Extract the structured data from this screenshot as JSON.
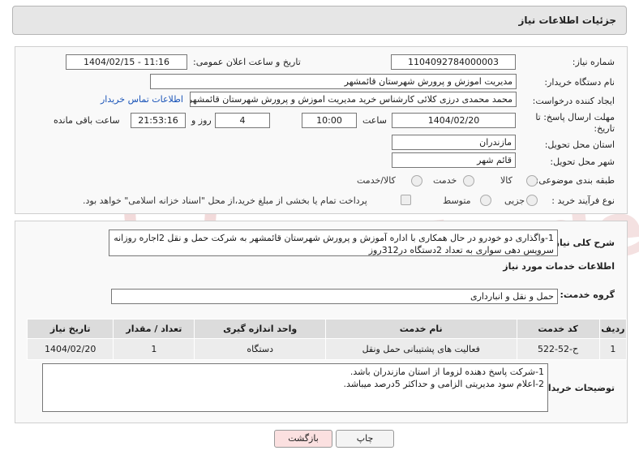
{
  "header": {
    "title": "جزئیات اطلاعات نیاز"
  },
  "form": {
    "need_number_label": "شماره نیاز:",
    "need_number": "1104092784000003",
    "announce_label": "تاریخ و ساعت اعلان عمومی:",
    "announce_value": "1404/02/15 - 11:16",
    "buyer_org_label": "نام دستگاه خریدار:",
    "buyer_org": "مدیریت اموزش و پرورش شهرستان قائمشهر",
    "creator_label": "ایجاد کننده درخواست:",
    "creator": "محمد محمدی درزی کلائی کارشناس خرید مدیریت اموزش و پرورش شهرستان قائمشهر",
    "contact_link": "اطلاعات تماس خریدار",
    "deadline_label_1": "مهلت ارسال پاسخ: تا",
    "deadline_label_2": "تاریخ:",
    "deadline_date": "1404/02/20",
    "time_label": "ساعت",
    "deadline_time": "10:00",
    "days_value": "4",
    "days_label": "روز و",
    "remaining_time": "21:53:16",
    "remaining_label": "ساعت باقی مانده",
    "province_label": "استان محل تحویل:",
    "province": "مازندران",
    "city_label": "شهر محل تحویل:",
    "city": "قائم شهر",
    "category_label": "طبقه بندی موضوعی:",
    "category_options": [
      "کالا",
      "خدمت",
      "کالا/خدمت"
    ],
    "process_label": "نوع فرآیند خرید :",
    "process_options": [
      "جزیی",
      "متوسط"
    ],
    "payment_note": "پرداخت تمام یا بخشی از مبلغ خرید،از محل \"اسناد خزانه اسلامی\" خواهد بود."
  },
  "summary": {
    "label": "شرح کلی نیاز:",
    "text": "1-واگذاری دو خودرو در حال همکاری با اداره آموزش و پرورش شهرستان قائمشهر به شرکت حمل و نقل 2اجاره روزانه سرویس دهی سواری به تعداد 2دستگاه در312روز"
  },
  "services": {
    "section_title": "اطلاعات خدمات مورد نیاز",
    "group_label": "گروه خدمت:",
    "group_value": "حمل و نقل و انبارداری",
    "columns": [
      "ردیف",
      "کد خدمت",
      "نام خدمت",
      "واحد اندازه گیری",
      "تعداد / مقدار",
      "تاریخ نیاز"
    ],
    "rows": [
      [
        "1",
        "ح-52-522",
        "فعالیت های پشتیبانی حمل ونقل",
        "دستگاه",
        "1",
        "1404/02/20"
      ]
    ]
  },
  "buyer_notes": {
    "label": "توضیحات خریدار:",
    "line1": "1-شرکت پاسخ دهنده لزوما از استان مازندران باشد.",
    "line2": "2-اعلام سود مدیریتی الزامی و حداکثر 5درصد میباشد."
  },
  "buttons": {
    "print": "چاپ",
    "back": "بازگشت"
  },
  "watermark": {
    "text": "AriaTender.net"
  },
  "colors": {
    "link": "#1a54b8",
    "back_button_bg": "#fbe0e0",
    "header_bg": "#e6e6e6",
    "watermark": "#f2dede"
  }
}
